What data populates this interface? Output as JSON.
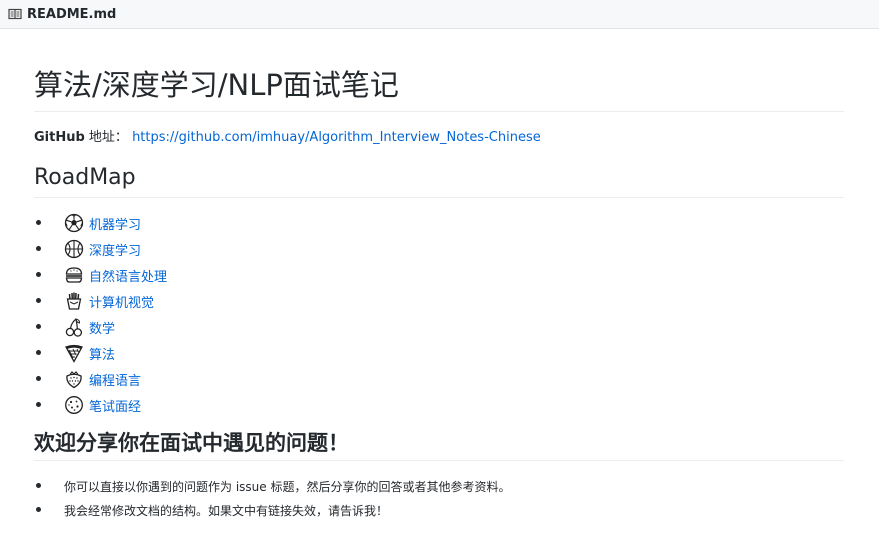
{
  "file_header": {
    "icon": "book-icon",
    "filename": "README.md"
  },
  "readme": {
    "title": "算法/深度学习/NLP面试笔记",
    "github": {
      "label": "GitHub",
      "suffix": " 地址：",
      "url": "https://github.com/imhuay/Algorithm_Interview_Notes-Chinese"
    },
    "roadmap": {
      "heading": "RoadMap",
      "items": [
        {
          "icon": "soccer-ball-icon",
          "label": "机器学习"
        },
        {
          "icon": "basketball-icon",
          "label": "深度学习"
        },
        {
          "icon": "hamburger-icon",
          "label": "自然语言处理"
        },
        {
          "icon": "fries-icon",
          "label": "计算机视觉"
        },
        {
          "icon": "cherries-icon",
          "label": "数学"
        },
        {
          "icon": "pizza-icon",
          "label": "算法"
        },
        {
          "icon": "strawberry-icon",
          "label": "编程语言"
        },
        {
          "icon": "cookie-icon",
          "label": "笔试面经"
        }
      ]
    },
    "welcome": {
      "heading": "欢迎分享你在面试中遇见的问题！",
      "items": [
        "你可以直接以你遇到的问题作为 issue 标题，然后分享你的回答或者其他参考资料。",
        "我会经常修改文档的结构。如果文中有链接失效，请告诉我！"
      ]
    }
  }
}
